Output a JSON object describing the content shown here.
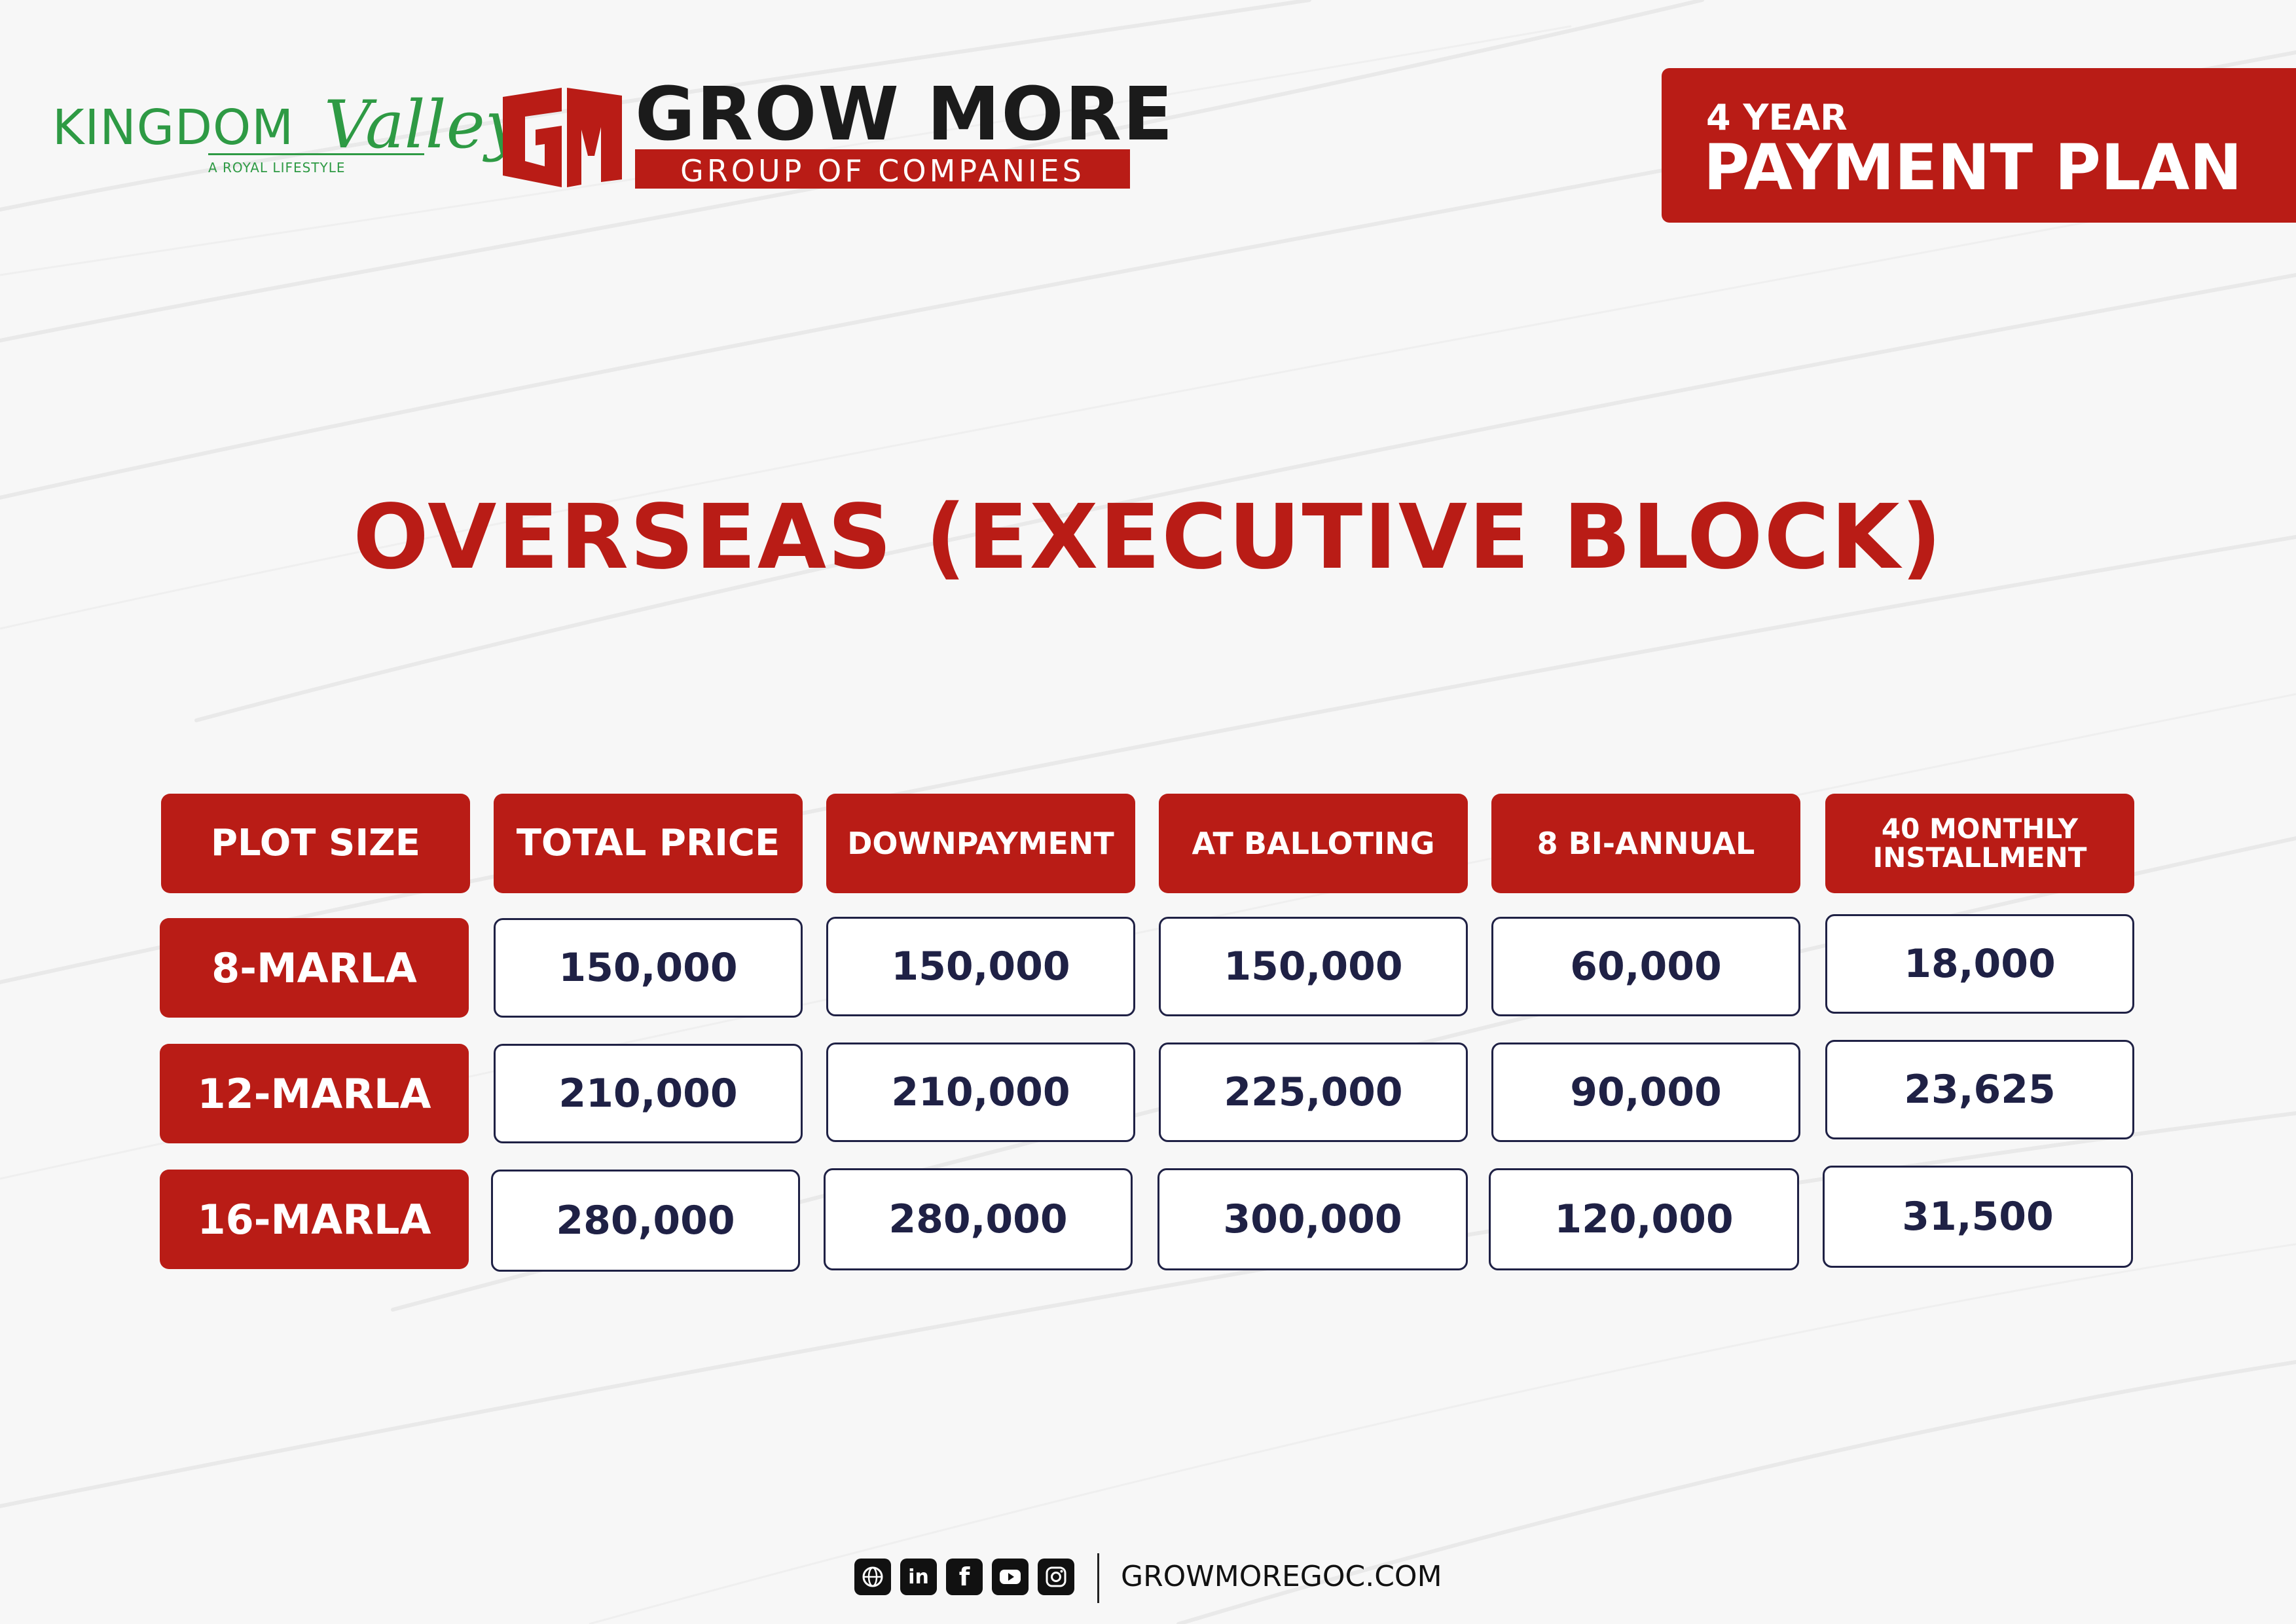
{
  "branding": {
    "kingdom_valley": {
      "kingdom": "KINGDOM",
      "valley": "Valley",
      "tagline": "A ROYAL LIFESTYLE"
    },
    "grow_more": {
      "title": "GROW MORE",
      "subtitle": "GROUP OF COMPANIES",
      "mark_letters": "GM"
    },
    "colors": {
      "brand_red": "#b91c16",
      "kingdom_green": "#2e9a44",
      "navy_text": "#1f2145"
    }
  },
  "plan_badge": {
    "duration": "4 YEAR",
    "name": "PAYMENT PLAN"
  },
  "title": "OVERSEAS (EXECUTIVE BLOCK)",
  "table": {
    "headers": [
      "PLOT SIZE",
      "TOTAL PRICE",
      "DOWNPAYMENT",
      "AT BALLOTING",
      "8 BI-ANNUAL",
      "40 MONTHLY\nINSTALLMENT"
    ],
    "rows": [
      {
        "plot_size": "8-MARLA",
        "values": [
          "150,000",
          "150,000",
          "150,000",
          "60,000",
          "18,000"
        ]
      },
      {
        "plot_size": "12-MARLA",
        "values": [
          "210,000",
          "210,000",
          "225,000",
          "90,000",
          "23,625"
        ]
      },
      {
        "plot_size": "16-MARLA",
        "values": [
          "280,000",
          "280,000",
          "300,000",
          "120,000",
          "31,500"
        ]
      }
    ]
  },
  "footer": {
    "icons": [
      "web-icon",
      "linkedin-icon",
      "facebook-icon",
      "youtube-icon",
      "instagram-icon"
    ],
    "website": "GROWMOREGOC.COM"
  }
}
